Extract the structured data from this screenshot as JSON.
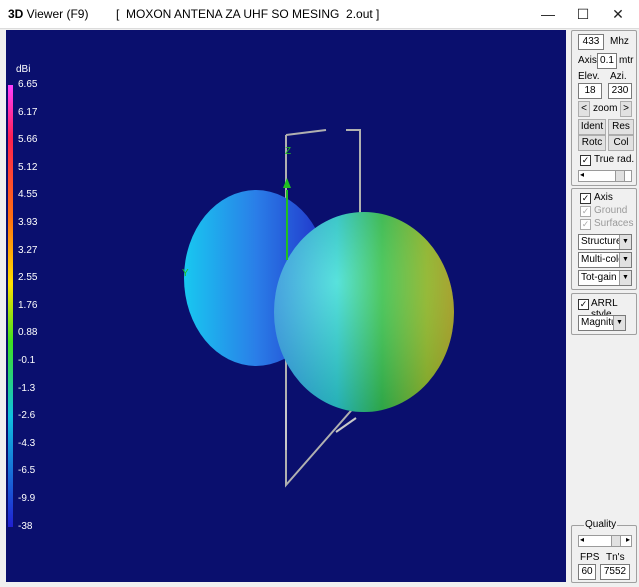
{
  "window": {
    "app_bold": "3D",
    "app_rest": " Viewer (F9)",
    "document": "[  MOXON ANTENA ZA UHF SO MESING  2.out ]",
    "minimize": "—",
    "maximize": "☐",
    "close": "✕"
  },
  "scale": {
    "unit": "dBi",
    "ticks": [
      "6.65",
      "6.17",
      "5.66",
      "5.12",
      "4.55",
      "3.93",
      "3.27",
      "2.55",
      "1.76",
      "0.88",
      "-0.1",
      "-1.3",
      "-2.6",
      "-4.3",
      "-6.5",
      "-9.9",
      "-38"
    ]
  },
  "plot_labels": {
    "z_axis": "Z",
    "y_axis": "Y"
  },
  "controls": {
    "frequency": "433",
    "frequency_unit": "Mhz",
    "axis_label": "Axis",
    "axis_value": "0.1",
    "axis_unit": "mtr",
    "elev_label": "Elev.",
    "azi_label": "Azi.",
    "elev_value": "18",
    "azi_value": "230",
    "zoom_left": "<",
    "zoom_label": "zoom",
    "zoom_right": ">",
    "ident": "Ident",
    "res": "Res",
    "rotc": "Rotc",
    "col": "Col",
    "true_rad": "True rad.",
    "axis_check": "Axis",
    "ground": "Ground",
    "surfaces": "Surfaces",
    "structure": "Structure",
    "multicolor": "Multi-colo",
    "totgain": "Tot-gain",
    "arrl": "ARRL style",
    "magnitude": "Magnitu",
    "quality": "Quality",
    "fps_label": "FPS",
    "tns_label": "Tn's",
    "fps_value": "60",
    "tns_value": "7552",
    "check_mark": "✓",
    "arrow": "▼",
    "slider_left": "◂",
    "slider_right": "▸"
  },
  "colors": {
    "background": "#0a0f6e"
  }
}
